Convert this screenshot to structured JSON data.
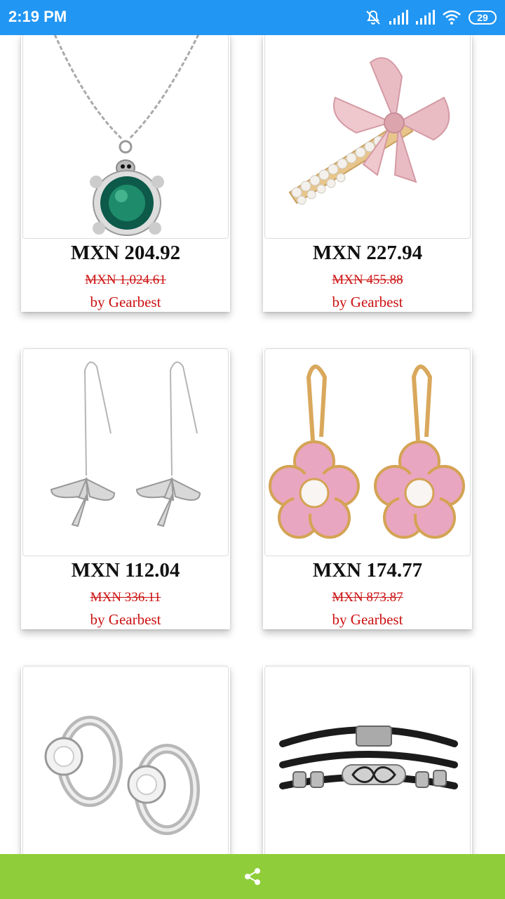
{
  "status_bar": {
    "time": "2:19 PM",
    "battery": "29",
    "icons": [
      "mute-icon",
      "signal-icon",
      "signal-icon",
      "wifi-icon",
      "battery-icon"
    ]
  },
  "products": [
    {
      "price": "MXN 204.92",
      "old_price": "MXN 1,024.61",
      "seller": "by Gearbest",
      "image": "turtle-pendant-necklace"
    },
    {
      "price": "MXN 227.94",
      "old_price": "MXN 455.88",
      "seller": "by Gearbest",
      "image": "pearl-bow-hair-clip"
    },
    {
      "price": "MXN 112.04",
      "old_price": "MXN 336.11",
      "seller": "by Gearbest",
      "image": "dragonfly-threader-earrings"
    },
    {
      "price": "MXN 174.77",
      "old_price": "MXN 873.87",
      "seller": "by Gearbest",
      "image": "pink-flower-pearl-earrings"
    },
    {
      "image": "crystal-hoop-earrings"
    },
    {
      "image": "infinity-leather-bracelet"
    }
  ],
  "bottom_bar": {
    "icon": "share-icon"
  },
  "colors": {
    "status_bar": "#2196f3",
    "bottom_bar": "#8fce3a",
    "sale_red": "#cc1111"
  }
}
